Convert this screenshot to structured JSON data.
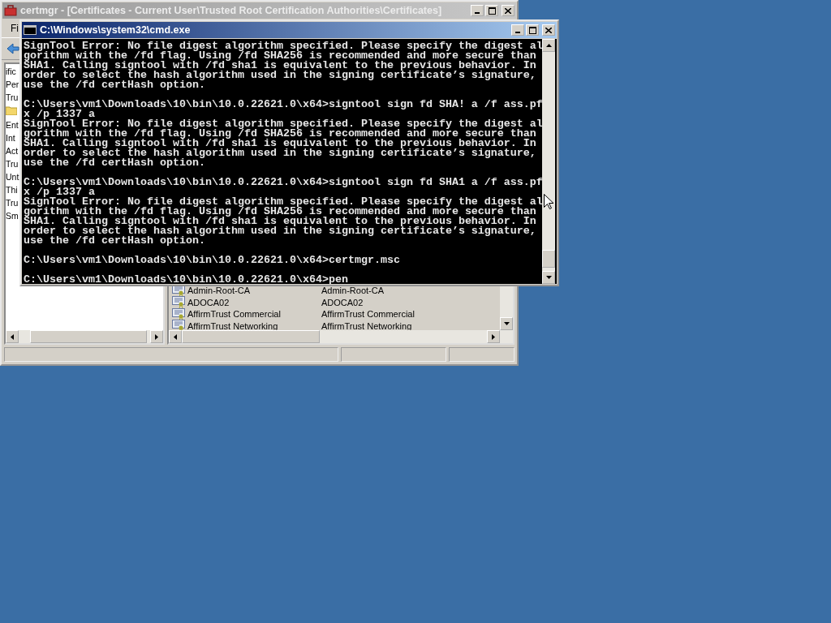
{
  "certmgr_window": {
    "title": "certmgr - [Certificates - Current User\\Trusted Root Certification Authorities\\Certificates]",
    "active": false,
    "menu": [
      "Fi"
    ],
    "tree_items": [
      {
        "kind": "text",
        "label": "ific"
      },
      {
        "kind": "text",
        "label": "Per"
      },
      {
        "kind": "text",
        "label": "Tru"
      },
      {
        "kind": "folder"
      },
      {
        "kind": "text",
        "label": "Ent"
      },
      {
        "kind": "text",
        "label": "Int"
      },
      {
        "kind": "text",
        "label": "Act"
      },
      {
        "kind": "text",
        "label": "Tru"
      },
      {
        "kind": "text",
        "label": "Unt"
      },
      {
        "kind": "text",
        "label": "Thi"
      },
      {
        "kind": "text",
        "label": "Tru"
      },
      {
        "kind": "text",
        "label": "Sm"
      }
    ],
    "list_rows": [
      {
        "column_1": "Admin-Root-CA",
        "column_2": "Admin-Root-CA"
      },
      {
        "column_1": "ADOCA02",
        "column_2": "ADOCA02"
      },
      {
        "column_1": "AffirmTrust Commercial",
        "column_2": "AffirmTrust Commercial"
      },
      {
        "column_1": "AffirmTrust Networking",
        "column_2": "AffirmTrust Networking"
      }
    ]
  },
  "cmd_window": {
    "title": "C:\\Windows\\system32\\cmd.exe",
    "active": true,
    "console_blocks": [
      [
        "SignTool Error: No file digest algorithm specified. Please specify the digest al",
        "gorithm with the /fd flag. Using /fd SHA256 is recommended and more secure than",
        "SHA1. Calling signtool with /fd sha1 is equivalent to the previous behavior. In",
        "order to select the hash algorithm used in the signing certificate’s signature,",
        "use the /fd certHash option."
      ],
      [
        "C:\\Users\\vm1\\Downloads\\10\\bin\\10.0.22621.0\\x64>signtool sign fd SHA! a /f ass.pf",
        "x /p 1337 a",
        "SignTool Error: No file digest algorithm specified. Please specify the digest al",
        "gorithm with the /fd flag. Using /fd SHA256 is recommended and more secure than",
        "SHA1. Calling signtool with /fd sha1 is equivalent to the previous behavior. In",
        "order to select the hash algorithm used in the signing certificate’s signature,",
        "use the /fd certHash option."
      ],
      [
        "C:\\Users\\vm1\\Downloads\\10\\bin\\10.0.22621.0\\x64>signtool sign fd SHA1 a /f ass.pf",
        "x /p 1337 a",
        "SignTool Error: No file digest algorithm specified. Please specify the digest al",
        "gorithm with the /fd flag. Using /fd SHA256 is recommended and more secure than",
        "SHA1. Calling signtool with /fd sha1 is equivalent to the previous behavior. In",
        "order to select the hash algorithm used in the signing certificate’s signature,",
        "use the /fd certHash option."
      ],
      [
        "C:\\Users\\vm1\\Downloads\\10\\bin\\10.0.22621.0\\x64>certmgr.msc"
      ],
      [
        "C:\\Users\\vm1\\Downloads\\10\\bin\\10.0.22621.0\\x64>pen"
      ]
    ]
  }
}
